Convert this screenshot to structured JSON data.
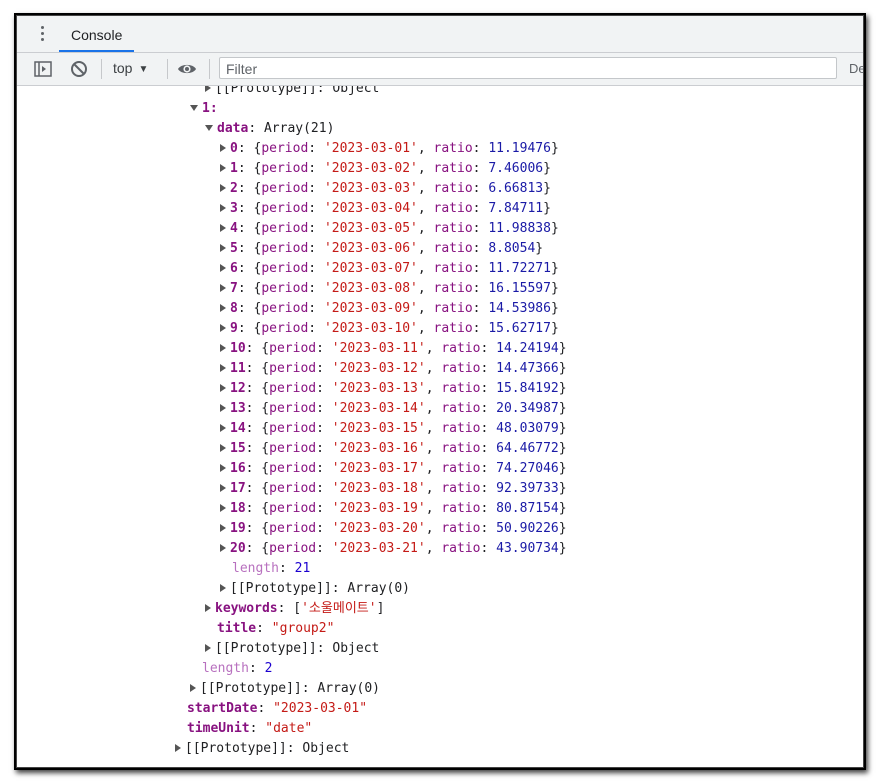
{
  "tabbar": {
    "tab_label": "Console"
  },
  "toolbar": {
    "context": "top",
    "filter_placeholder": "Filter",
    "levels_label": "De"
  },
  "console": {
    "proto_top": "[[Prototype]]: Object",
    "index1": "1:",
    "data_key": "data",
    "data_value": "Array(21)",
    "entries": [
      {
        "index": "0",
        "period": "'2023-03-01'",
        "ratio": "11.19476"
      },
      {
        "index": "1",
        "period": "'2023-03-02'",
        "ratio": "7.46006"
      },
      {
        "index": "2",
        "period": "'2023-03-03'",
        "ratio": "6.66813"
      },
      {
        "index": "3",
        "period": "'2023-03-04'",
        "ratio": "7.84711"
      },
      {
        "index": "4",
        "period": "'2023-03-05'",
        "ratio": "11.98838"
      },
      {
        "index": "5",
        "period": "'2023-03-06'",
        "ratio": "8.8054"
      },
      {
        "index": "6",
        "period": "'2023-03-07'",
        "ratio": "11.72271"
      },
      {
        "index": "7",
        "period": "'2023-03-08'",
        "ratio": "16.15597"
      },
      {
        "index": "8",
        "period": "'2023-03-09'",
        "ratio": "14.53986"
      },
      {
        "index": "9",
        "period": "'2023-03-10'",
        "ratio": "15.62717"
      },
      {
        "index": "10",
        "period": "'2023-03-11'",
        "ratio": "14.24194"
      },
      {
        "index": "11",
        "period": "'2023-03-12'",
        "ratio": "14.47366"
      },
      {
        "index": "12",
        "period": "'2023-03-13'",
        "ratio": "15.84192"
      },
      {
        "index": "13",
        "period": "'2023-03-14'",
        "ratio": "20.34987"
      },
      {
        "index": "14",
        "period": "'2023-03-15'",
        "ratio": "48.03079"
      },
      {
        "index": "15",
        "period": "'2023-03-16'",
        "ratio": "64.46772"
      },
      {
        "index": "16",
        "period": "'2023-03-17'",
        "ratio": "74.27046"
      },
      {
        "index": "17",
        "period": "'2023-03-18'",
        "ratio": "92.39733"
      },
      {
        "index": "18",
        "period": "'2023-03-19'",
        "ratio": "80.87154"
      },
      {
        "index": "19",
        "period": "'2023-03-20'",
        "ratio": "50.90226"
      },
      {
        "index": "20",
        "period": "'2023-03-21'",
        "ratio": "43.90734"
      }
    ],
    "period_key": "period",
    "ratio_key": "ratio",
    "inner_length_key": "length",
    "inner_length_value": "21",
    "proto_array": "[[Prototype]]: Array(0)",
    "keywords_key": "keywords",
    "keywords_value": "'소울메이트'",
    "title_key": "title",
    "title_value": "\"group2\"",
    "proto_object": "[[Prototype]]: Object",
    "outer_length_key": "length",
    "outer_length_value": "2",
    "proto_array_outer": "[[Prototype]]: Array(0)",
    "startdate_key": "startDate",
    "startdate_value": "\"2023-03-01\"",
    "timeunit_key": "timeUnit",
    "timeunit_value": "\"date\"",
    "proto_root": "[[Prototype]]: Object"
  }
}
